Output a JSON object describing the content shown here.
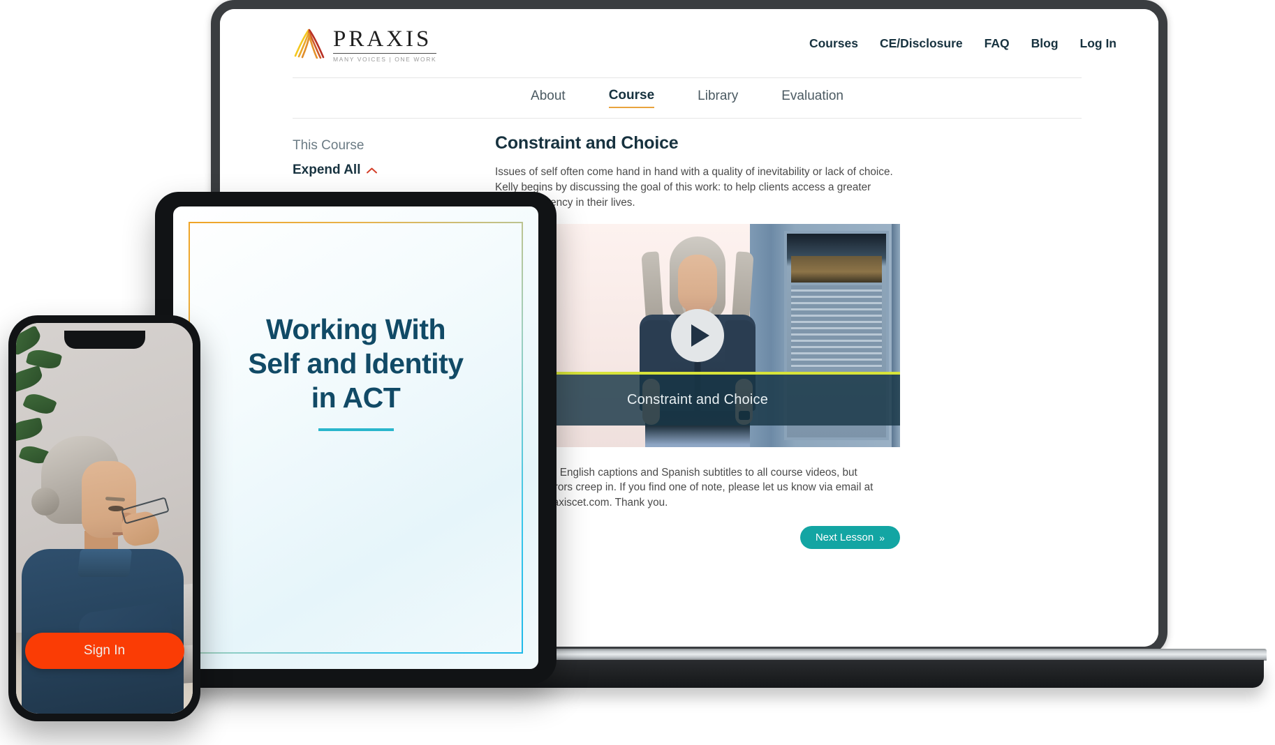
{
  "site": {
    "logo": {
      "name": "PRAXIS",
      "tagline": "MANY VOICES  |  ONE WORK",
      "mark_colors": [
        "#f0c419",
        "#e8a33d",
        "#d4572e",
        "#b32d20"
      ]
    },
    "top_nav": [
      {
        "label": "Courses"
      },
      {
        "label": "CE/Disclosure"
      },
      {
        "label": "FAQ"
      },
      {
        "label": "Blog"
      },
      {
        "label": "Log In"
      }
    ],
    "sub_nav": [
      {
        "label": "About",
        "active": false
      },
      {
        "label": "Course",
        "active": true
      },
      {
        "label": "Library",
        "active": false
      },
      {
        "label": "Evaluation",
        "active": false
      }
    ]
  },
  "sidebar": {
    "title": "This Course",
    "expand_label": "Expend All",
    "chevron_icon": "chevron-up-icon",
    "chevron_color": "#d4402a"
  },
  "lesson": {
    "title": "Constraint and Choice",
    "description": "Issues of self often come hand in hand with a quality of inevitability or lack of choice. Kelly begins by discussing the goal of this work: to help clients access a greater sense of agency in their lives.",
    "video": {
      "caption": "Constraint and Choice",
      "play_icon": "play-icon",
      "accent_line_color": "#d7e33a",
      "caption_bar_color": "#173646"
    },
    "note": "We've added English captions and Spanish subtitles to all course videos, but inevitably, errors creep in. If you find one of note, please let us know via email at courses@praxiscet.com. Thank you.",
    "next_button": {
      "label": "Next Lesson",
      "chevron": "»",
      "color": "#13a5a3"
    }
  },
  "tablet": {
    "title_line1": "Working With",
    "title_line2": "Self and Identity",
    "title_line3": "in ACT",
    "rule_color": "#2ab6cc",
    "frame_gradient_from": "#efa426",
    "frame_gradient_to": "#1fb9e8"
  },
  "phone": {
    "signin_label": "Sign In",
    "signin_color": "#fa3c05"
  }
}
